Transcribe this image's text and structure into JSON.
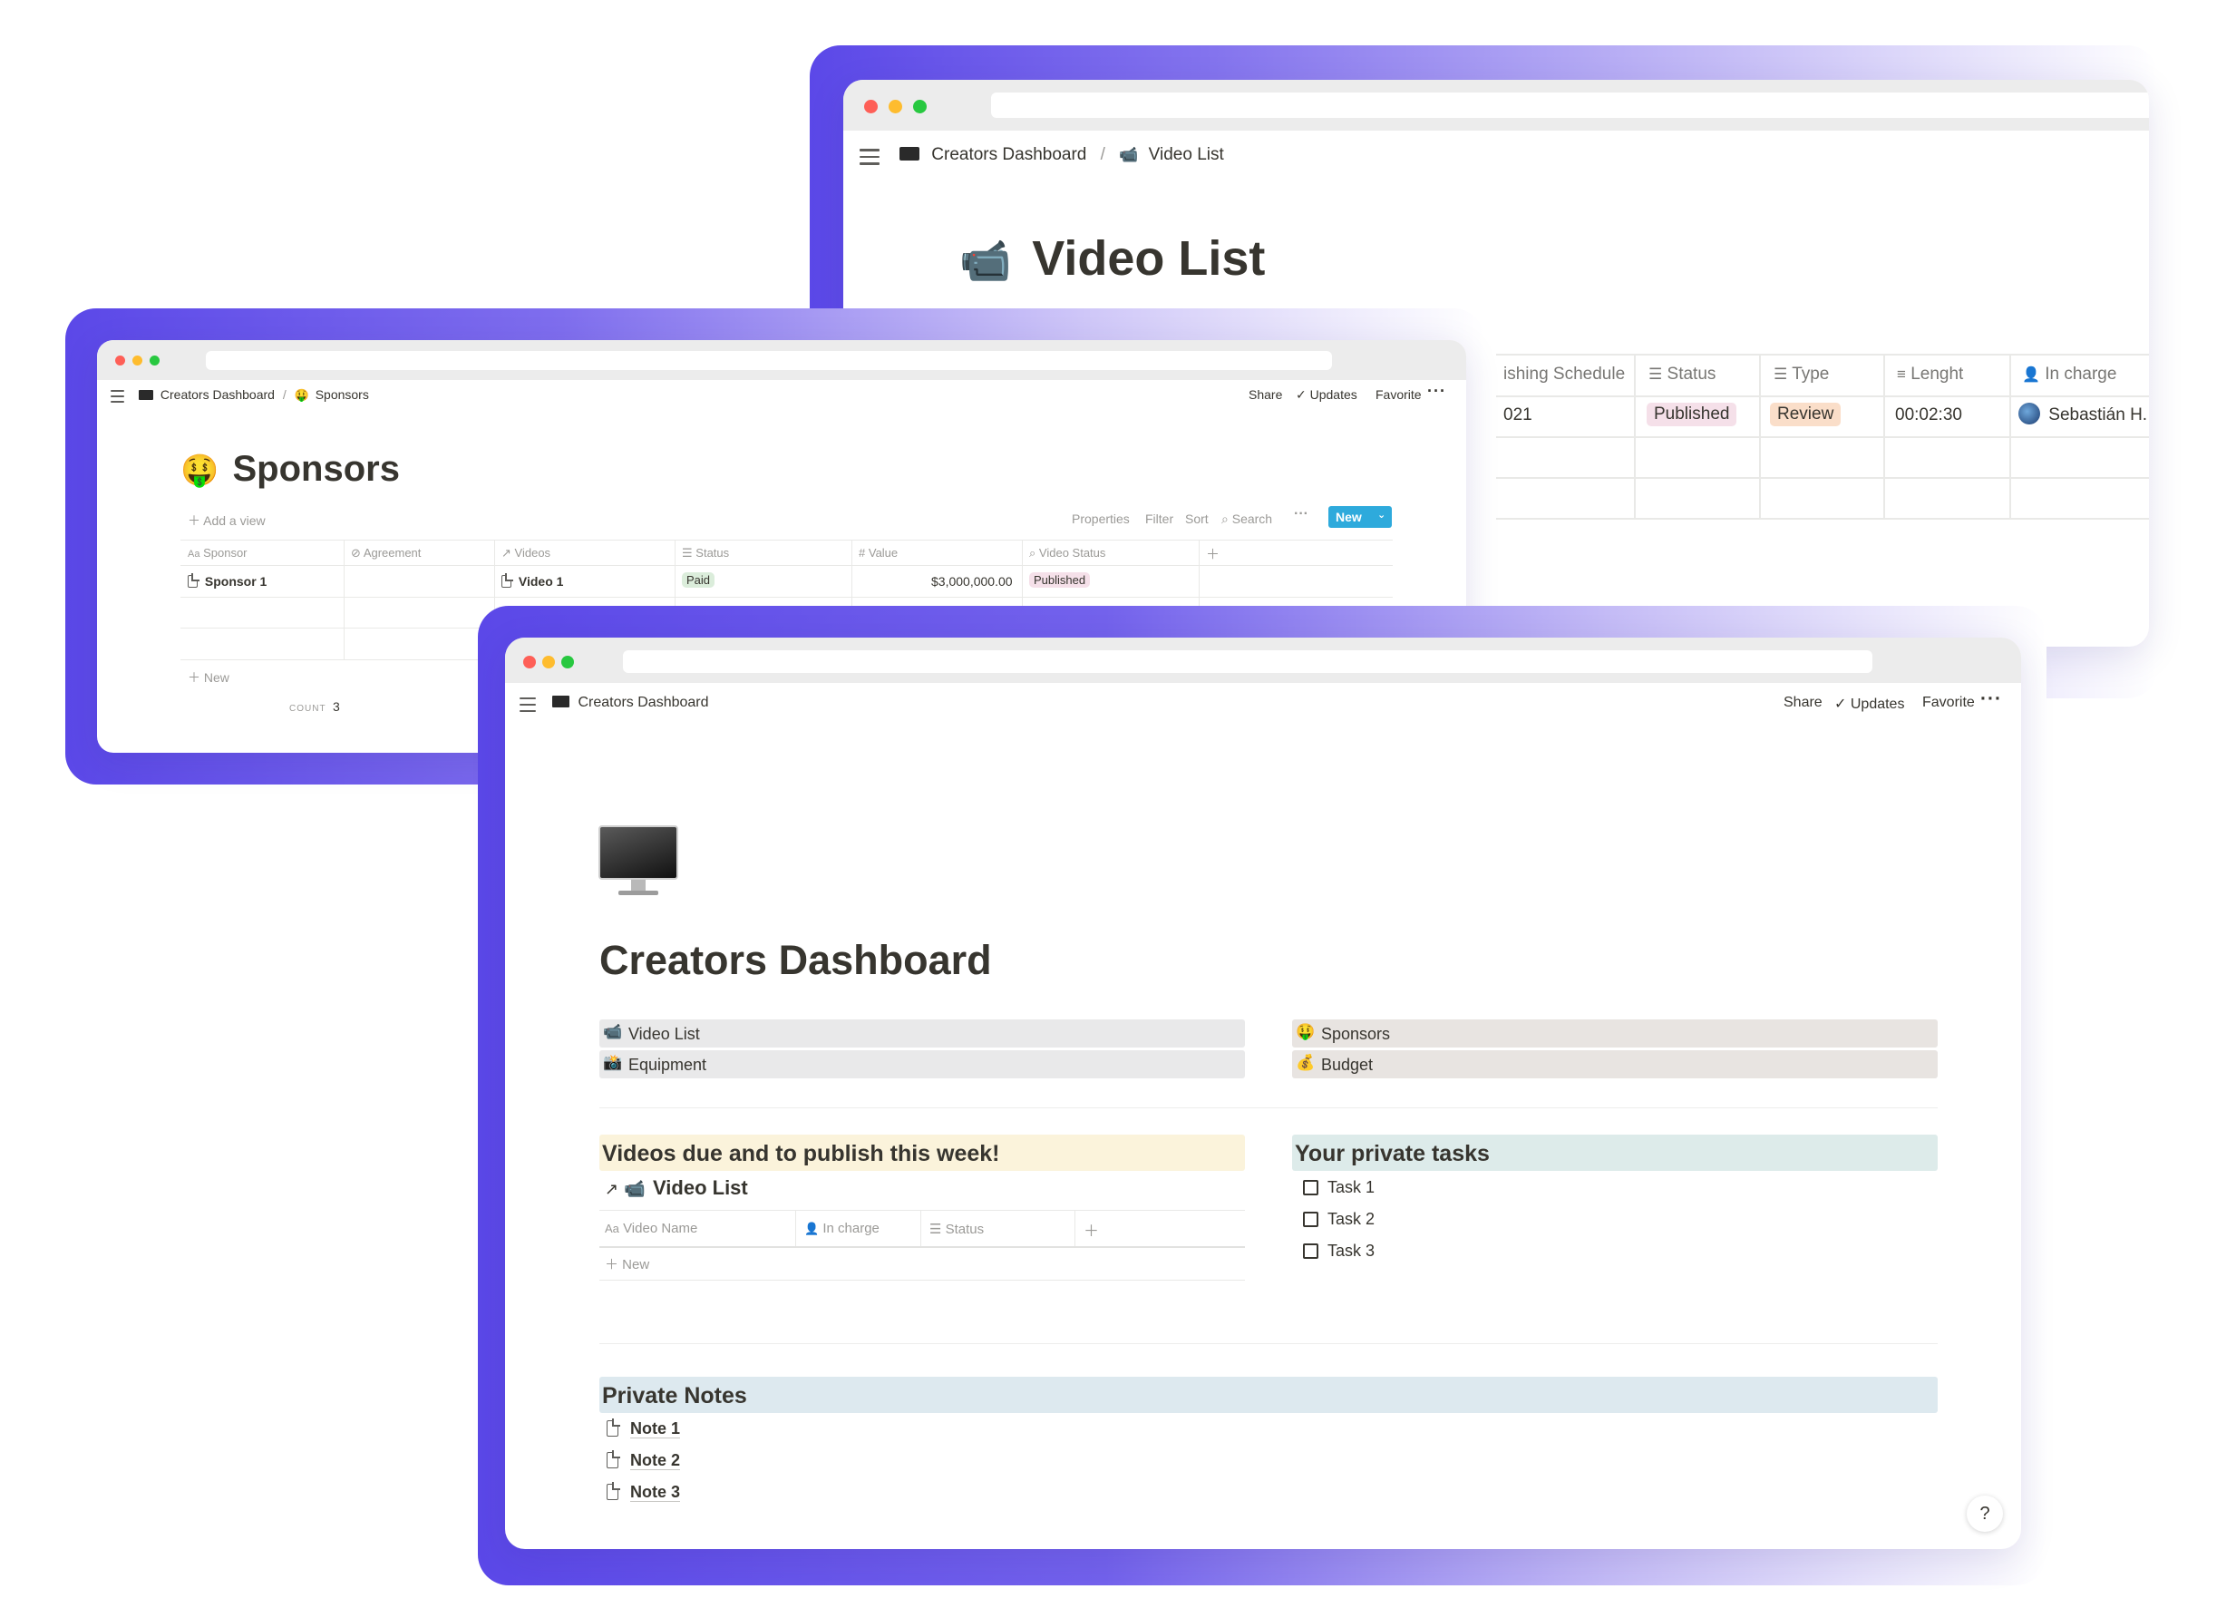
{
  "colors": {
    "accent_purple": "#5b48e8",
    "new_button": "#2eaadc",
    "published_bg": "#f5e0e9",
    "paid_bg": "#dbeddb",
    "review_bg": "#fadec9"
  },
  "video_list_window": {
    "breadcrumb": [
      "Creators Dashboard",
      "Video List"
    ],
    "title": "Video List",
    "title_icon": "video-camera-emoji",
    "columns": [
      "ishing Schedule",
      "Status",
      "Type",
      "Lenght",
      "In charge"
    ],
    "row": {
      "schedule": "021",
      "status": "Published",
      "type": "Review",
      "length": "00:02:30",
      "in_charge": "Sebastián H."
    }
  },
  "sponsors_window": {
    "breadcrumb": [
      "Creators Dashboard",
      "Sponsors"
    ],
    "topbar": {
      "share": "Share",
      "updates": "Updates",
      "favorite": "Favorite"
    },
    "title": "Sponsors",
    "title_icon": "money-mouth-face-emoji",
    "add_view": "Add a view",
    "toolbar": {
      "properties": "Properties",
      "filter": "Filter",
      "sort": "Sort",
      "search": "Search",
      "new": "New"
    },
    "columns": [
      "Sponsor",
      "Agreement",
      "Videos",
      "Status",
      "Value",
      "Video Status"
    ],
    "row": {
      "sponsor": "Sponsor 1",
      "video": "Video 1",
      "status": "Paid",
      "value": "$3,000,000.00",
      "video_status": "Published"
    },
    "new_row": "New",
    "count_label": "COUNT",
    "count_value": "3"
  },
  "dashboard_window": {
    "breadcrumb": "Creators Dashboard",
    "topbar": {
      "share": "Share",
      "updates": "Updates",
      "favorite": "Favorite"
    },
    "page_icon": "desktop-computer-emoji",
    "title": "Creators Dashboard",
    "links_left": [
      {
        "icon": "video-camera-emoji",
        "label": "Video List"
      },
      {
        "icon": "camera-flash-emoji",
        "label": "Equipment"
      }
    ],
    "links_right": [
      {
        "icon": "money-mouth-face-emoji",
        "label": "Sponsors"
      },
      {
        "icon": "money-bag-emoji",
        "label": "Budget"
      }
    ],
    "due_heading": "Videos due and to publish this week!",
    "linked_db_title": "Video List",
    "linked_db_columns": [
      "Video Name",
      "In charge",
      "Status"
    ],
    "linked_db_new": "New",
    "tasks_heading": "Your private tasks",
    "tasks": [
      "Task 1",
      "Task 2",
      "Task 3"
    ],
    "notes_heading": "Private Notes",
    "notes": [
      "Note 1",
      "Note 2",
      "Note 3"
    ],
    "help": "?"
  }
}
